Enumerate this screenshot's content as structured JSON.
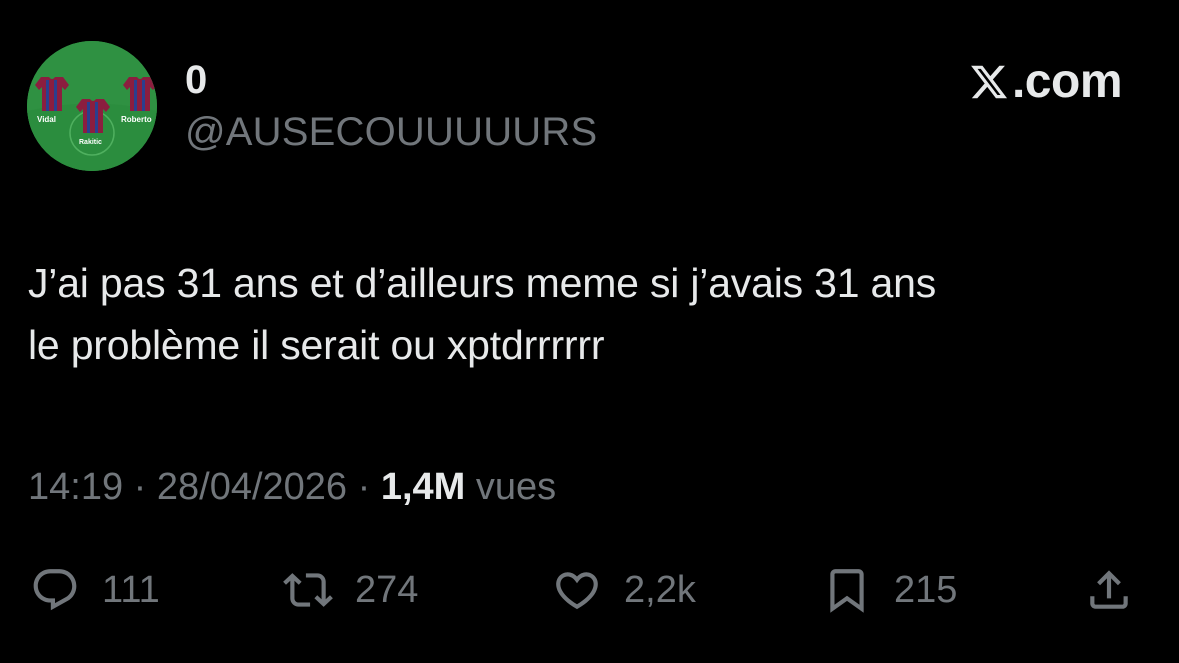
{
  "author": {
    "display_name": "0",
    "handle": "@AUSECOUUUUURS",
    "avatar": {
      "description_icon": "football-lineup-avatar",
      "players": [
        "Vidal",
        "Roberto",
        "Rakitic"
      ],
      "background_color": "#2e8b3e",
      "jersey_color": "#8b1e3f"
    }
  },
  "brand": {
    "icon": "x-logo-icon",
    "text": ".com"
  },
  "tweet": {
    "lines": [
      "J’ai pas 31 ans et d’ailleurs meme si j’avais 31 ans",
      "le problème il serait ou xptdrrrrrr"
    ]
  },
  "meta": {
    "time": "14:19",
    "separator1": " · ",
    "date": "28/04/2026",
    "separator2": " · ",
    "views_count": "1,4M",
    "views_label": " vues"
  },
  "actions": {
    "reply": {
      "icon": "reply-icon",
      "count": "111"
    },
    "retweet": {
      "icon": "retweet-icon",
      "count": "274"
    },
    "like": {
      "icon": "heart-icon",
      "count": "2,2k"
    },
    "bookmark": {
      "icon": "bookmark-icon",
      "count": "215"
    },
    "share": {
      "icon": "share-icon"
    }
  },
  "colors": {
    "background": "#000000",
    "primary_text": "#e7e9ea",
    "secondary_text": "#71767b"
  }
}
